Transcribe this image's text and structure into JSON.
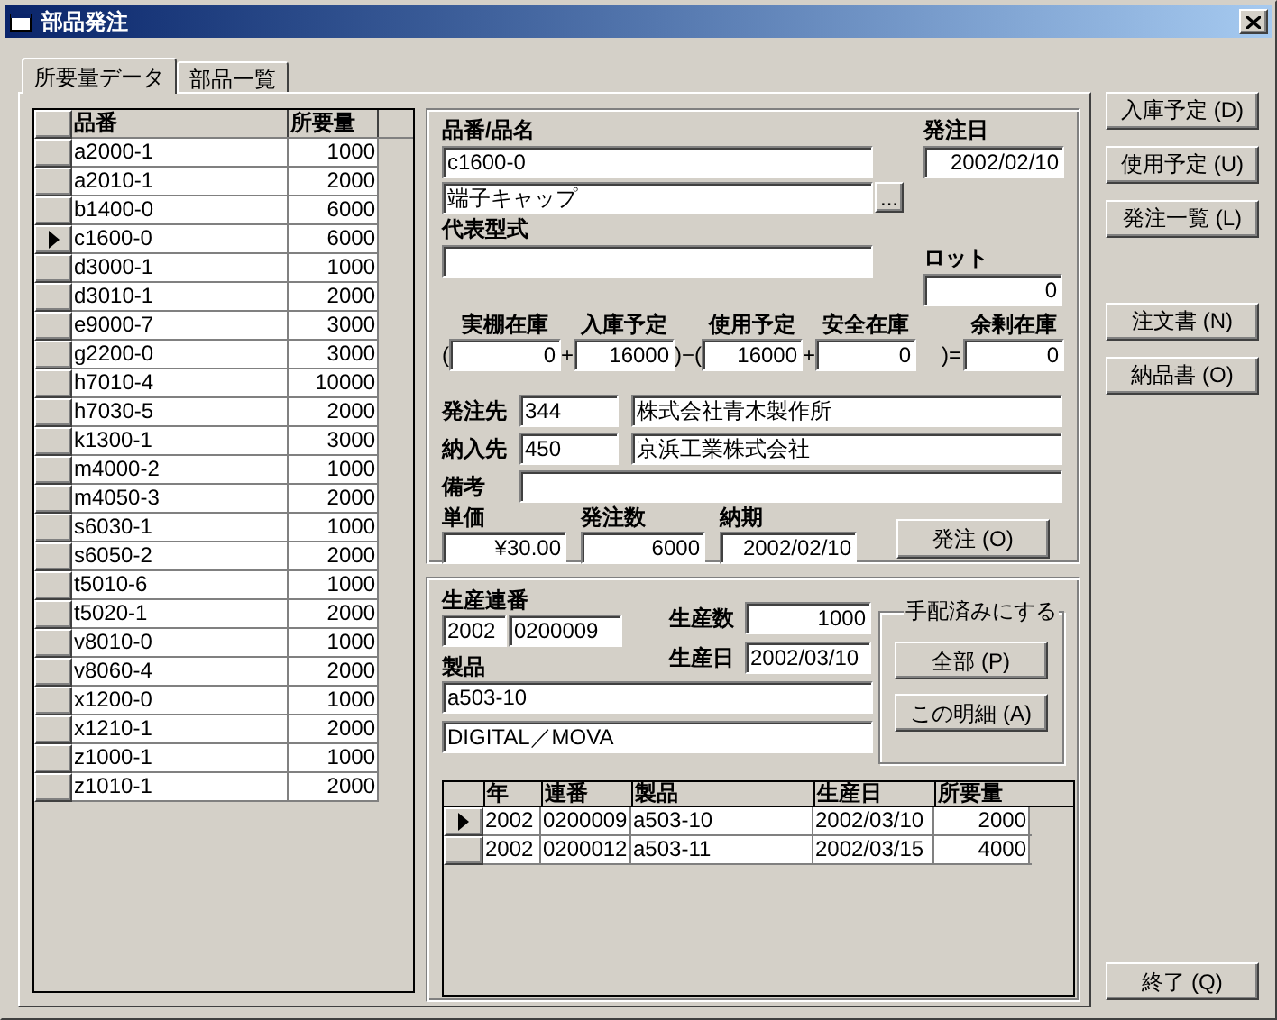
{
  "window": {
    "title": "部品発注"
  },
  "tabs": [
    {
      "label": "所要量データ",
      "selected": true
    },
    {
      "label": "部品一覧",
      "selected": false
    }
  ],
  "parts_grid": {
    "columns": [
      "品番",
      "所要量"
    ],
    "rows": [
      {
        "part": "a2000-1",
        "qty": "1000",
        "selected": false
      },
      {
        "part": "a2010-1",
        "qty": "2000",
        "selected": false
      },
      {
        "part": "b1400-0",
        "qty": "6000",
        "selected": false
      },
      {
        "part": "c1600-0",
        "qty": "6000",
        "selected": true
      },
      {
        "part": "d3000-1",
        "qty": "1000",
        "selected": false
      },
      {
        "part": "d3010-1",
        "qty": "2000",
        "selected": false
      },
      {
        "part": "e9000-7",
        "qty": "3000",
        "selected": false
      },
      {
        "part": "g2200-0",
        "qty": "3000",
        "selected": false
      },
      {
        "part": "h7010-4",
        "qty": "10000",
        "selected": false
      },
      {
        "part": "h7030-5",
        "qty": "2000",
        "selected": false
      },
      {
        "part": "k1300-1",
        "qty": "3000",
        "selected": false
      },
      {
        "part": "m4000-2",
        "qty": "1000",
        "selected": false
      },
      {
        "part": "m4050-3",
        "qty": "2000",
        "selected": false
      },
      {
        "part": "s6030-1",
        "qty": "1000",
        "selected": false
      },
      {
        "part": "s6050-2",
        "qty": "2000",
        "selected": false
      },
      {
        "part": "t5010-6",
        "qty": "1000",
        "selected": false
      },
      {
        "part": "t5020-1",
        "qty": "2000",
        "selected": false
      },
      {
        "part": "v8010-0",
        "qty": "1000",
        "selected": false
      },
      {
        "part": "v8060-4",
        "qty": "2000",
        "selected": false
      },
      {
        "part": "x1200-0",
        "qty": "1000",
        "selected": false
      },
      {
        "part": "x1210-1",
        "qty": "2000",
        "selected": false
      },
      {
        "part": "z1000-1",
        "qty": "1000",
        "selected": false
      },
      {
        "part": "z1010-1",
        "qty": "2000",
        "selected": false
      }
    ]
  },
  "order": {
    "part_label": "品番/品名",
    "part_no": "c1600-0",
    "part_name": "端子キャップ",
    "browse_button": "...",
    "order_date_label": "発注日",
    "order_date": "2002/02/10",
    "model_label": "代表型式",
    "lot_label": "ロット",
    "lot": "0",
    "stock": [
      {
        "operator": "(",
        "label": "実棚在庫",
        "value": "0"
      },
      {
        "operator": "+",
        "label": "入庫予定",
        "value": "16000"
      },
      {
        "operator": ")−(",
        "label": "使用予定",
        "value": "16000"
      },
      {
        "operator": "+",
        "label": "安全在庫",
        "value": "0"
      },
      {
        "operator": ")=",
        "label": "余剰在庫",
        "value": "0"
      }
    ],
    "supplier_label": "発注先",
    "supplier_code": "344",
    "supplier_name": "株式会社青木製作所",
    "delivery_label": "納入先",
    "delivery_code": "450",
    "delivery_name": "京浜工業株式会社",
    "remarks_label": "備考",
    "price_label": "単価",
    "price": "¥30.00",
    "quantity_label": "発注数",
    "quantity": "6000",
    "due_label": "納期",
    "due": "2002/02/10",
    "order_button": "発注 (O)"
  },
  "production": {
    "serial_label": "生産連番",
    "serial_year": "2002",
    "serial_no": "0200009",
    "count_label": "生産数",
    "count": "1000",
    "date_label": "生産日",
    "date": "2002/03/10",
    "product_label": "製品",
    "product_code": "a503-10",
    "product_name": "DIGITAL／MOVA",
    "arranged_group": {
      "title": "手配済みにする",
      "buttons": [
        "全部 (P)",
        "この明細 (A)"
      ]
    },
    "grid": {
      "columns": [
        "年",
        "連番",
        "製品",
        "生産日",
        "所要量"
      ],
      "rows": [
        {
          "year": "2002",
          "serial": "0200009",
          "product": "a503-10",
          "date": "2002/03/10",
          "qty": "2000",
          "selected": true
        },
        {
          "year": "2002",
          "serial": "0200012",
          "product": "a503-11",
          "date": "2002/03/15",
          "qty": "4000",
          "selected": false
        }
      ]
    }
  },
  "side_buttons": [
    "入庫予定 (D)",
    "使用予定 (U)",
    "発注一覧 (L)",
    "注文書 (N)",
    "納品書 (O)"
  ],
  "exit_button": "終了 (Q)"
}
